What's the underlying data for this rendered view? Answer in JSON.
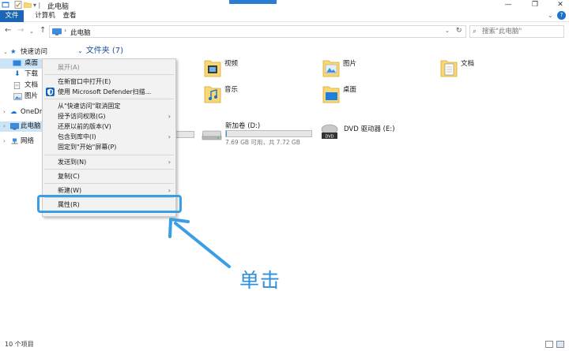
{
  "window": {
    "title": "此电脑"
  },
  "ribbon": {
    "tabs": [
      "文件",
      "计算机",
      "查看"
    ]
  },
  "address": {
    "path": "此电脑"
  },
  "search": {
    "placeholder": "搜索\"此电脑\""
  },
  "navpane": {
    "items": [
      {
        "label": "快速访问",
        "icon": "star-icon"
      },
      {
        "label": "桌面",
        "icon": "desktop-icon"
      },
      {
        "label": "下载",
        "icon": "download-icon"
      },
      {
        "label": "文档",
        "icon": "document-icon"
      },
      {
        "label": "图片",
        "icon": "picture-icon"
      },
      {
        "label": "OneDrive",
        "icon": "cloud-icon"
      },
      {
        "label": "此电脑",
        "icon": "computer-icon"
      },
      {
        "label": "网络",
        "icon": "network-icon"
      }
    ]
  },
  "content": {
    "folders_header": "文件夹 (7)",
    "folders": [
      {
        "label": "视频",
        "icon": "video-folder-icon"
      },
      {
        "label": "图片",
        "icon": "pictures-folder-icon"
      },
      {
        "label": "文档",
        "icon": "documents-folder-icon"
      },
      {
        "label": "音乐",
        "icon": "music-folder-icon"
      },
      {
        "label": "桌面",
        "icon": "desktop-folder-icon"
      }
    ],
    "drives": [
      {
        "label": "新加卷 (D:)",
        "free_text": "7.69 GB 可用，共 7.72 GB",
        "used_fraction": 0.004
      },
      {
        "label": "DVD 驱动器 (E:)"
      }
    ]
  },
  "context_menu": {
    "items": [
      {
        "label": "展开(A)",
        "disabled": true
      },
      {
        "label": "在新窗口中打开(E)"
      },
      {
        "label": "使用 Microsoft Defender扫描..."
      },
      {
        "label": "从\"快速访问\"取消固定"
      },
      {
        "label": "授予访问权限(G)",
        "submenu": true
      },
      {
        "label": "还原以前的版本(V)"
      },
      {
        "label": "包含到库中(I)",
        "submenu": true
      },
      {
        "label": "固定到\"开始\"屏幕(P)"
      },
      {
        "label": "发送到(N)",
        "submenu": true
      },
      {
        "label": "复制(C)"
      },
      {
        "label": "新建(W)",
        "submenu": true
      },
      {
        "label": "属性(R)"
      }
    ]
  },
  "annotation": {
    "text": "单击",
    "color": "#3b9ee5"
  },
  "status": {
    "item_count": "10 个项目"
  },
  "colors": {
    "accent": "#1a66b5",
    "selection": "#cce4f7",
    "drive_bar": "#26a0da"
  }
}
